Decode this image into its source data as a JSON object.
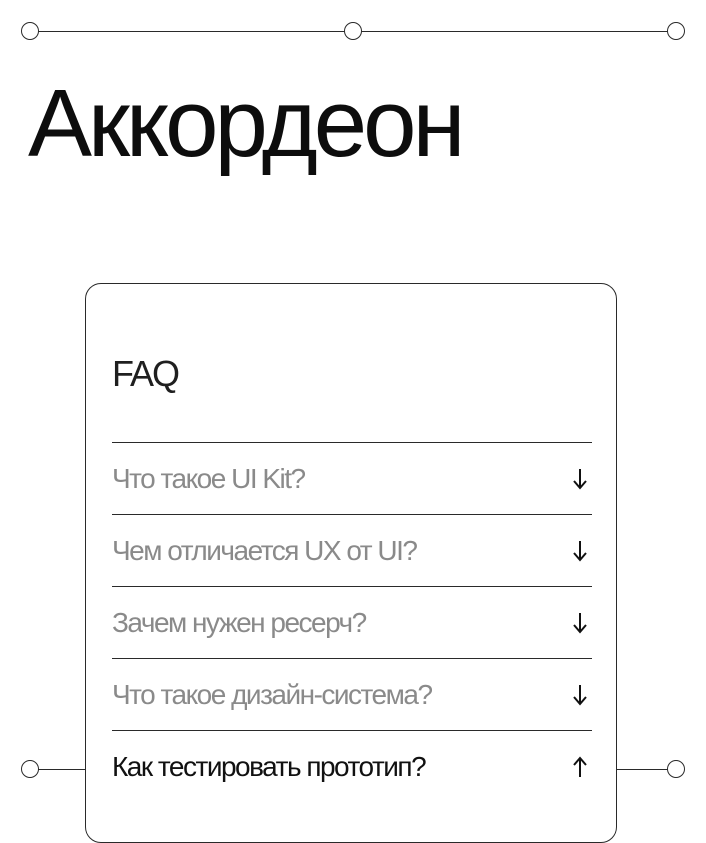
{
  "page": {
    "title": "Аккордеон"
  },
  "faq": {
    "heading": "FAQ",
    "items": [
      {
        "question": "Что такое UI Kit?",
        "state": "collapsed",
        "icon": "arrow-down-icon"
      },
      {
        "question": "Чем отличается UX от UI?",
        "state": "collapsed",
        "icon": "arrow-down-icon"
      },
      {
        "question": "Зачем нужен ресерч?",
        "state": "collapsed",
        "icon": "arrow-down-icon"
      },
      {
        "question": "Что такое дизайн-система?",
        "state": "collapsed",
        "icon": "arrow-down-icon"
      },
      {
        "question": "Как тестировать прототип?",
        "state": "expanded",
        "icon": "arrow-up-icon"
      }
    ]
  },
  "colors": {
    "text_primary": "#111111",
    "text_muted": "#8a8a8a",
    "line": "#2a2a2a",
    "background": "#ffffff"
  }
}
